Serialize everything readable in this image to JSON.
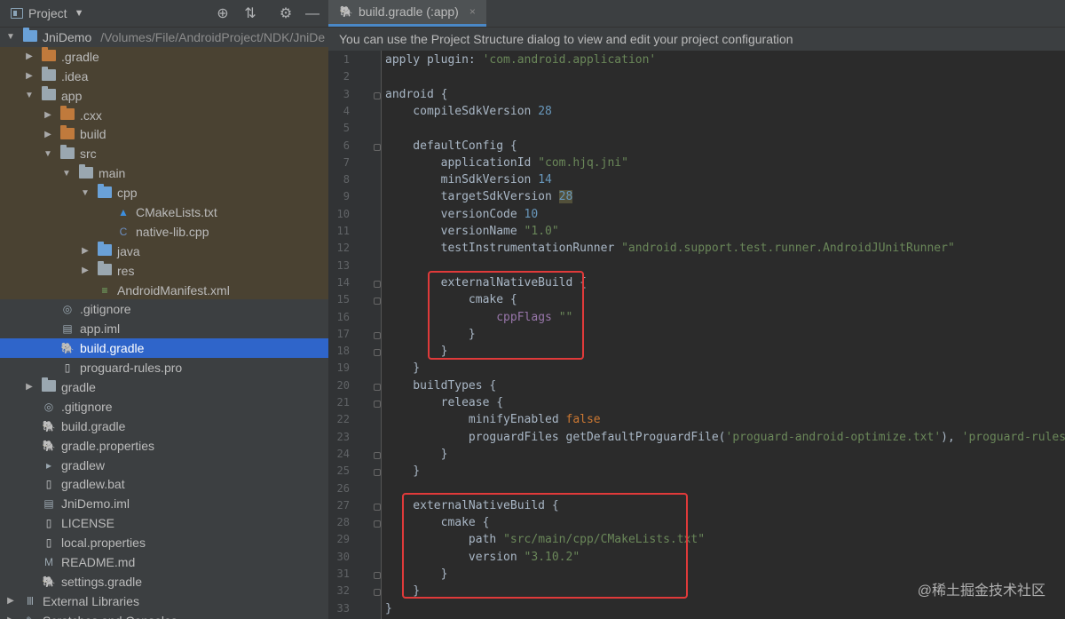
{
  "project_panel": {
    "title": "Project",
    "caret": "▼",
    "toolbar": {
      "target": "⊕",
      "collapse": "⇅",
      "settings": "⚙",
      "hide": "—"
    },
    "items": [
      {
        "label": "JniDemo",
        "hint": "/Volumes/File/AndroidProject/NDK/JniDe",
        "depth": 0,
        "arrow": "▼",
        "icon": "folder-blue"
      },
      {
        "label": ".gradle",
        "depth": 1,
        "arrow": "▶",
        "icon": "folder-orange"
      },
      {
        "label": ".idea",
        "depth": 1,
        "arrow": "▶",
        "icon": "folder-gray"
      },
      {
        "label": "app",
        "depth": 1,
        "arrow": "▼",
        "icon": "folder-gray"
      },
      {
        "label": ".cxx",
        "depth": 2,
        "arrow": "▶",
        "icon": "folder-orange"
      },
      {
        "label": "build",
        "depth": 2,
        "arrow": "▶",
        "icon": "folder-orange"
      },
      {
        "label": "src",
        "depth": 2,
        "arrow": "▼",
        "icon": "folder-gray"
      },
      {
        "label": "main",
        "depth": 3,
        "arrow": "▼",
        "icon": "folder-gray"
      },
      {
        "label": "cpp",
        "depth": 4,
        "arrow": "▼",
        "icon": "folder-blue"
      },
      {
        "label": "CMakeLists.txt",
        "depth": 5,
        "arrow": "",
        "icon": "cmake"
      },
      {
        "label": "native-lib.cpp",
        "depth": 5,
        "arrow": "",
        "icon": "cpp"
      },
      {
        "label": "java",
        "depth": 4,
        "arrow": "▶",
        "icon": "folder-blue"
      },
      {
        "label": "res",
        "depth": 4,
        "arrow": "▶",
        "icon": "folder-gray"
      },
      {
        "label": "AndroidManifest.xml",
        "depth": 4,
        "arrow": "",
        "icon": "manifest"
      },
      {
        "label": ".gitignore",
        "depth": 2,
        "arrow": "",
        "icon": "gitignore"
      },
      {
        "label": "app.iml",
        "depth": 2,
        "arrow": "",
        "icon": "iml"
      },
      {
        "label": "build.gradle",
        "depth": 2,
        "arrow": "",
        "icon": "gradle"
      },
      {
        "label": "proguard-rules.pro",
        "depth": 2,
        "arrow": "",
        "icon": "file"
      },
      {
        "label": "gradle",
        "depth": 1,
        "arrow": "▶",
        "icon": "folder-gray"
      },
      {
        "label": ".gitignore",
        "depth": 1,
        "arrow": "",
        "icon": "gitignore"
      },
      {
        "label": "build.gradle",
        "depth": 1,
        "arrow": "",
        "icon": "gradle"
      },
      {
        "label": "gradle.properties",
        "depth": 1,
        "arrow": "",
        "icon": "gradle"
      },
      {
        "label": "gradlew",
        "depth": 1,
        "arrow": "",
        "icon": "terminal"
      },
      {
        "label": "gradlew.bat",
        "depth": 1,
        "arrow": "",
        "icon": "file"
      },
      {
        "label": "JniDemo.iml",
        "depth": 1,
        "arrow": "",
        "icon": "iml"
      },
      {
        "label": "LICENSE",
        "depth": 1,
        "arrow": "",
        "icon": "file"
      },
      {
        "label": "local.properties",
        "depth": 1,
        "arrow": "",
        "icon": "file"
      },
      {
        "label": "README.md",
        "depth": 1,
        "arrow": "",
        "icon": "markdown"
      },
      {
        "label": "settings.gradle",
        "depth": 1,
        "arrow": "",
        "icon": "gradle"
      },
      {
        "label": "External Libraries",
        "depth": 0,
        "arrow": "▶",
        "icon": "libraries"
      },
      {
        "label": "Scratches and Consoles",
        "depth": 0,
        "arrow": "▶",
        "icon": "scratch"
      }
    ]
  },
  "editor": {
    "tab_label": "build.gradle (:app)",
    "tab_close": "×",
    "notice": "You can use the Project Structure dialog to view and edit your project configuration",
    "lines": [
      "apply plugin: 'com.android.application'",
      "",
      "android {",
      "    compileSdkVersion 28",
      "",
      "    defaultConfig {",
      "        applicationId \"com.hjq.jni\"",
      "        minSdkVersion 14",
      "        targetSdkVersion 28",
      "        versionCode 10",
      "        versionName \"1.0\"",
      "        testInstrumentationRunner \"android.support.test.runner.AndroidJUnitRunner\"",
      "",
      "        externalNativeBuild {",
      "            cmake {",
      "                cppFlags \"\"",
      "            }",
      "        }",
      "    }",
      "    buildTypes {",
      "        release {",
      "            minifyEnabled false",
      "            proguardFiles getDefaultProguardFile('proguard-android-optimize.txt'), 'proguard-rules.pro'",
      "        }",
      "    }",
      "",
      "    externalNativeBuild {",
      "        cmake {",
      "            path \"src/main/cpp/CMakeLists.txt\"",
      "            version \"3.10.2\"",
      "        }",
      "    }",
      "}"
    ]
  },
  "watermark": "@稀土掘金技术社区",
  "colors": {
    "panel_bg": "#3c3f41",
    "editor_bg": "#2b2b2b",
    "selection": "#2f65ca",
    "highlight_box": "#e03a3a",
    "keyword": "#cc7832",
    "string": "#6a8759",
    "number": "#6897bb"
  }
}
